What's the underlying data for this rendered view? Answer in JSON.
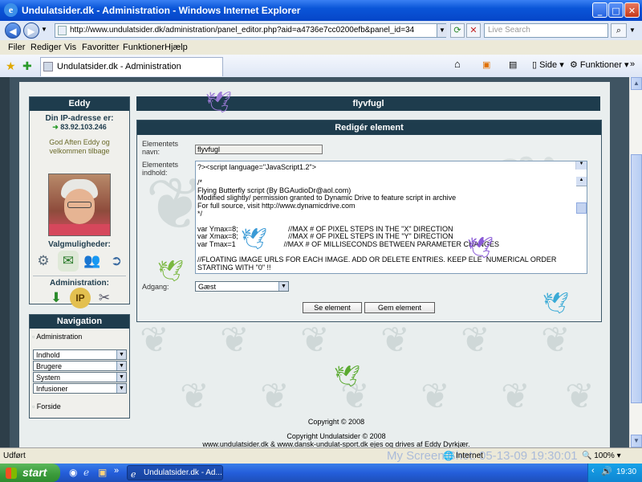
{
  "window": {
    "title": "Undulatsider.dk - Administration - Windows Internet Explorer",
    "min": "_",
    "max": "□",
    "close": "✕"
  },
  "address": {
    "url": "http://www.undulatsider.dk/administration/panel_editor.php?aid=a4736e7cc0200efb&panel_id=34",
    "search_placeholder": "Live Search"
  },
  "menu": [
    "Filer",
    "Rediger",
    "Vis",
    "Favoritter",
    "Funktioner",
    "Hjælp"
  ],
  "tabs": {
    "active": "Undulatsider.dk - Administration"
  },
  "toolbar": {
    "side": "Side",
    "funktioner": "Funktioner"
  },
  "user_panel": {
    "name": "Eddy",
    "ip_label": "Din IP-adresse er:",
    "ip": "83.92.103.246",
    "greeting": "God Aften Eddy og velkommen tilbage",
    "options_label": "Valgmuligheder:",
    "admin_label": "Administration:"
  },
  "nav": {
    "title": "Navigation",
    "admin_link": "Administration",
    "selects": [
      "Indhold",
      "Brugere",
      "System",
      "Infusioner"
    ],
    "front_link": "Forside"
  },
  "panel": {
    "title": "flyvfugl"
  },
  "edit": {
    "title": "Redigér element",
    "name_label": "Elementets navn:",
    "name_value": "flyvfugl",
    "content_label": "Elementets indhold:",
    "content_lines": [
      "?><script language=\"JavaScript1.2\">",
      "",
      "/*",
      "Flying Butterfly script (By BGAudioDr@aol.com)",
      "Modified slightly/ permission granted to Dynamic Drive to feature script in archive",
      "For full source, visit http://www.dynamicdrive.com",
      "*/",
      "",
      "var Ymax=8;                         //MAX # OF PIXEL STEPS IN THE \"X\" DIRECTION",
      "var Xmax=8;                         //MAX # OF PIXEL STEPS IN THE \"Y\" DIRECTION",
      "var Tmax=1                        //MAX # OF MILLISECONDS BETWEEN PARAMETER CHANGES",
      "",
      "//FLOATING IMAGE URLS FOR EACH IMAGE. ADD OR DELETE ENTRIES. KEEP ELE  NUMERICAL ORDER",
      "STARTING WITH \"0\" !!"
    ],
    "access_label": "Adgang:",
    "access_value": "Gæst",
    "preview_button": "Se element",
    "save_button": "Gem element"
  },
  "footer": {
    "copyright1": "Copyright © 2008",
    "copyright2": "Copyright Undulatsider © 2008",
    "owners": "www.undulatsider.dk & www.dansk-undulat-sport.dk ejes og drives af Eddy Dyrkjær."
  },
  "statusbar": {
    "left": "Udført",
    "zone": "Internet",
    "zoom": "100%",
    "watermark": "My Screen Shot: 05-13-09 19:30:01"
  },
  "taskbar": {
    "start": "start",
    "task": "Undulatsider.dk - Ad...",
    "time": "19:30"
  }
}
